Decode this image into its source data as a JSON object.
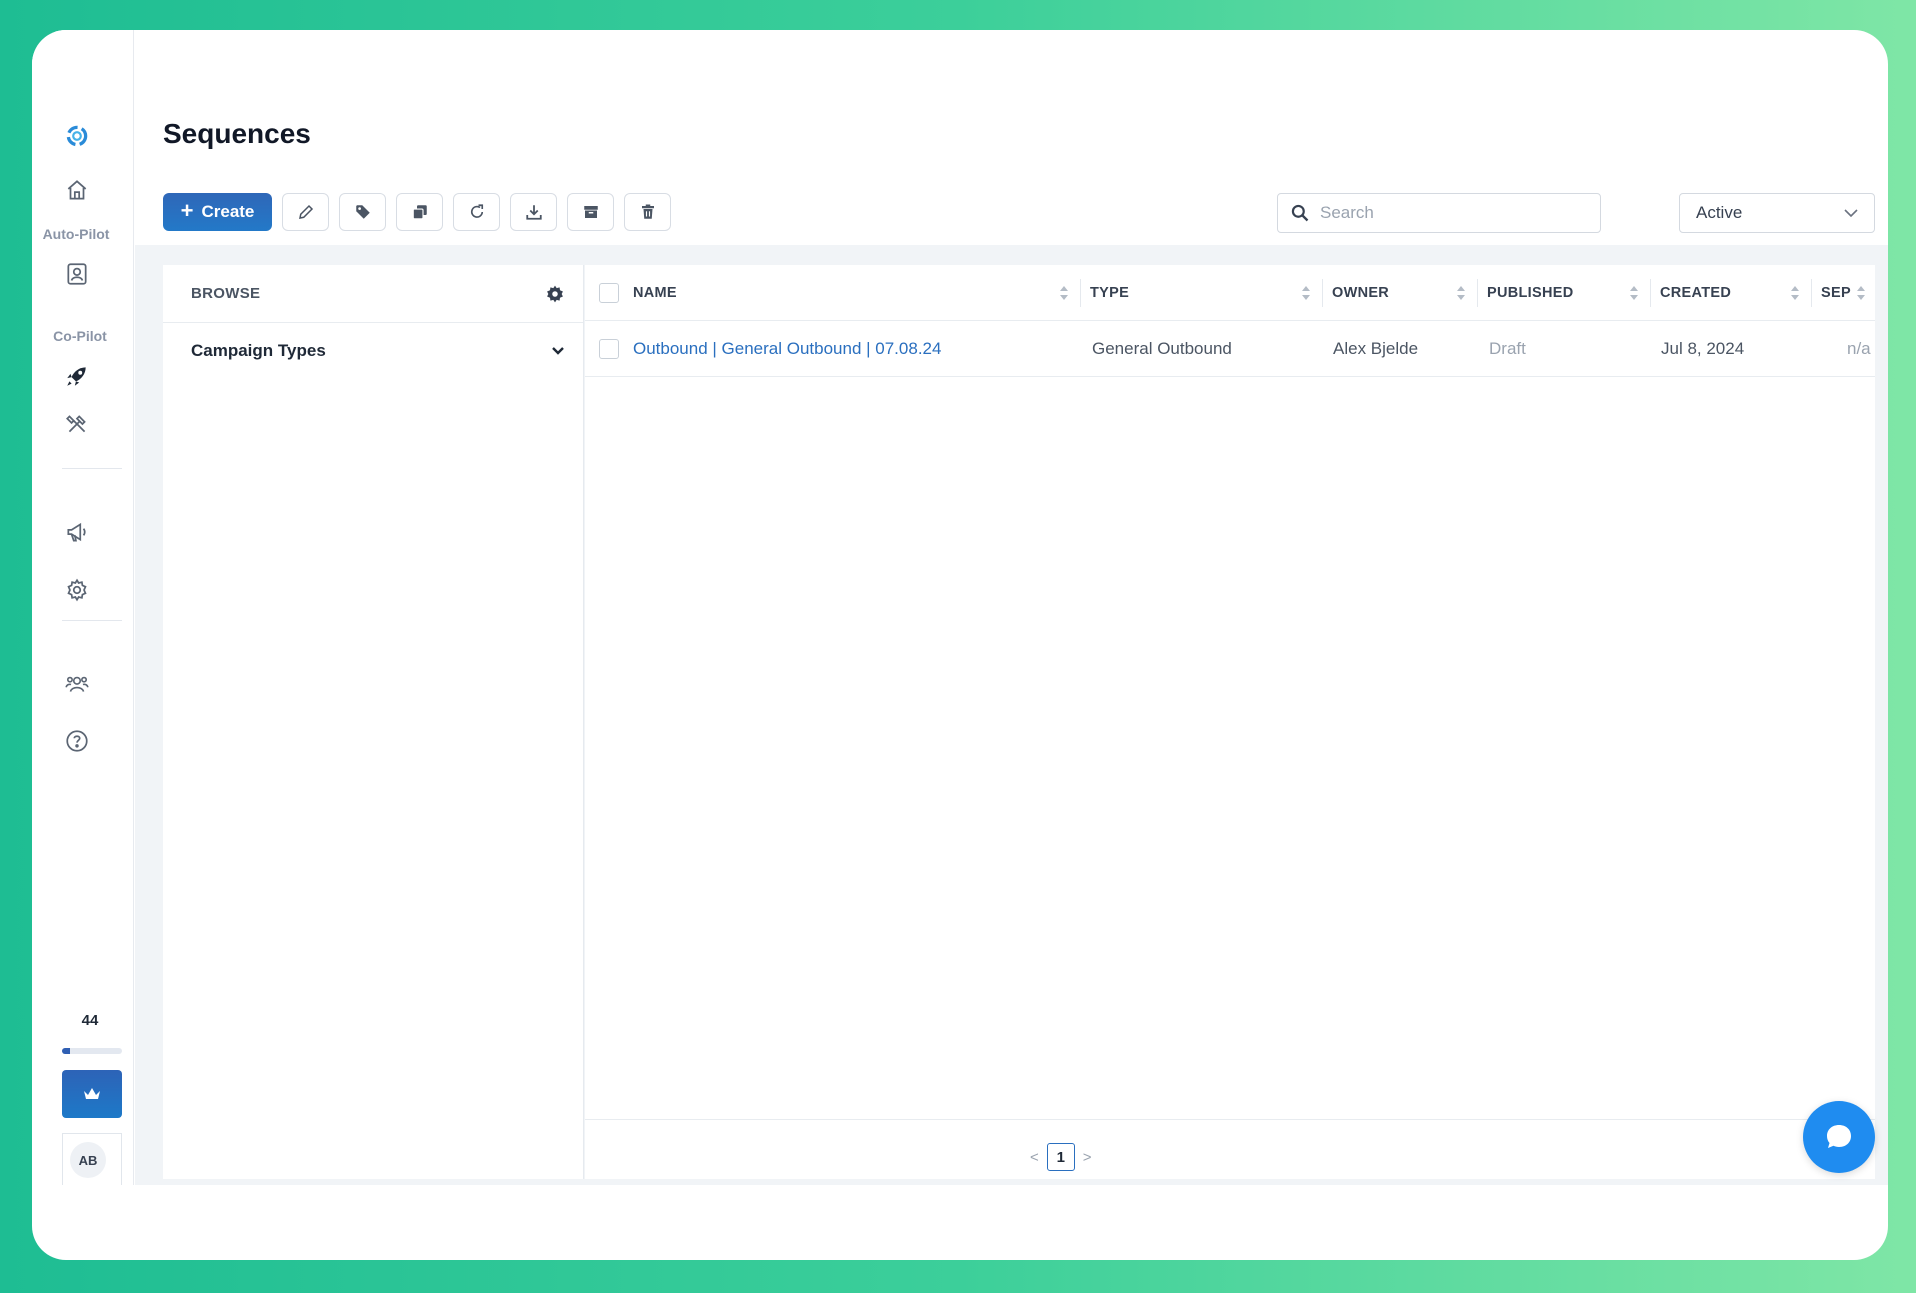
{
  "sidebar": {
    "sections": {
      "autopilot": "Auto-Pilot",
      "copilot": "Co-Pilot"
    },
    "icons": [
      "logo-icon",
      "home-icon",
      "contact-card-icon",
      "rocket-icon",
      "tools-icon",
      "megaphone-icon",
      "gear-icon",
      "team-icon",
      "help-icon"
    ],
    "credits": {
      "count": "44",
      "fraction_used": 0.14
    },
    "avatar_initials": "AB"
  },
  "header": {
    "title": "Sequences"
  },
  "toolbar": {
    "create_label": "Create",
    "tools": [
      "edit-icon",
      "tag-icon",
      "copy-icon",
      "refresh-icon",
      "download-icon",
      "archive-icon",
      "delete-icon"
    ]
  },
  "search": {
    "placeholder": "Search",
    "value": ""
  },
  "filter": {
    "selected": "Active"
  },
  "browse": {
    "heading": "BROWSE",
    "items": [
      {
        "label": "Campaign Types"
      }
    ]
  },
  "table": {
    "columns": [
      "NAME",
      "TYPE",
      "OWNER",
      "PUBLISHED",
      "CREATED",
      "SEP"
    ],
    "rows": [
      {
        "name": "Outbound | General Outbound | 07.08.24",
        "type": "General Outbound",
        "owner": "Alex Bjelde",
        "published": "Draft",
        "created": "Jul 8, 2024",
        "sep": "n/a"
      }
    ]
  },
  "pagination": {
    "current": "1",
    "prev": "<",
    "next": ">"
  },
  "colors": {
    "accent": "#2a6fbf",
    "brand_gradient_start": "#1ebd93",
    "brand_gradient_end": "#7fe6a6",
    "chat": "#1f8cf0"
  }
}
